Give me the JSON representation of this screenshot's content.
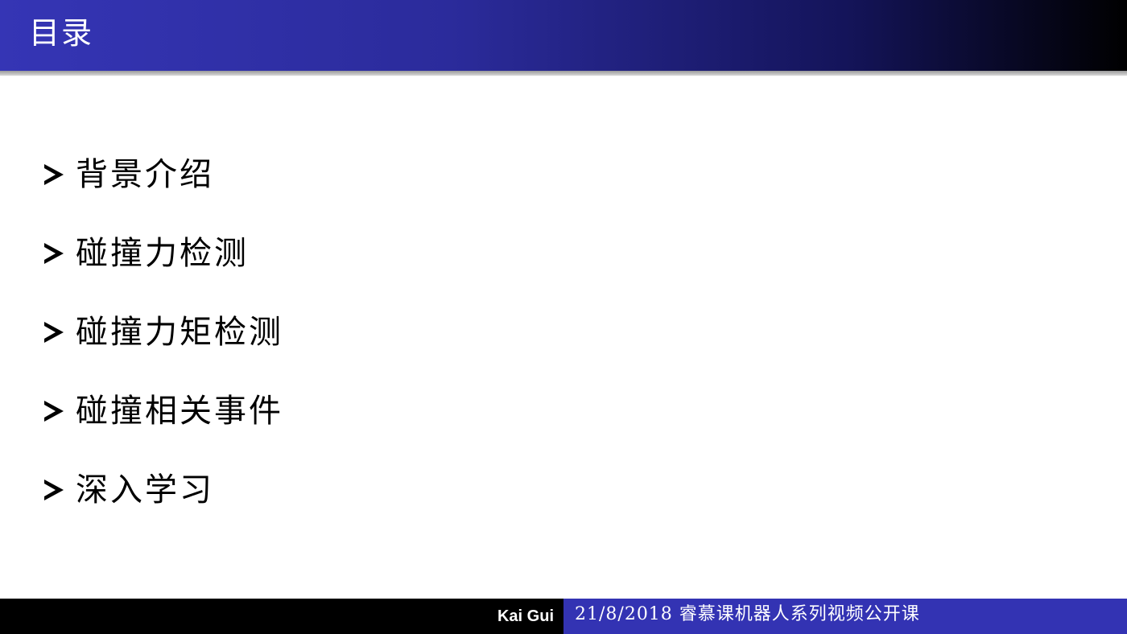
{
  "header": {
    "title": "目录"
  },
  "toc": {
    "bullet_icon": "right-arrowhead-icon",
    "items": [
      {
        "label": "背景介绍"
      },
      {
        "label": "碰撞力检测"
      },
      {
        "label": "碰撞力矩检测"
      },
      {
        "label": "碰撞相关事件"
      },
      {
        "label": "深入学习"
      }
    ]
  },
  "footer": {
    "author": "Kai Gui",
    "info": "21/8/2018 睿慕课机器人系列视频公开课"
  },
  "colors": {
    "header_start": "#3535b5",
    "header_end": "#000000",
    "footer_left_bg": "#000000",
    "footer_right_bg": "#3333b3",
    "text": "#000000"
  }
}
